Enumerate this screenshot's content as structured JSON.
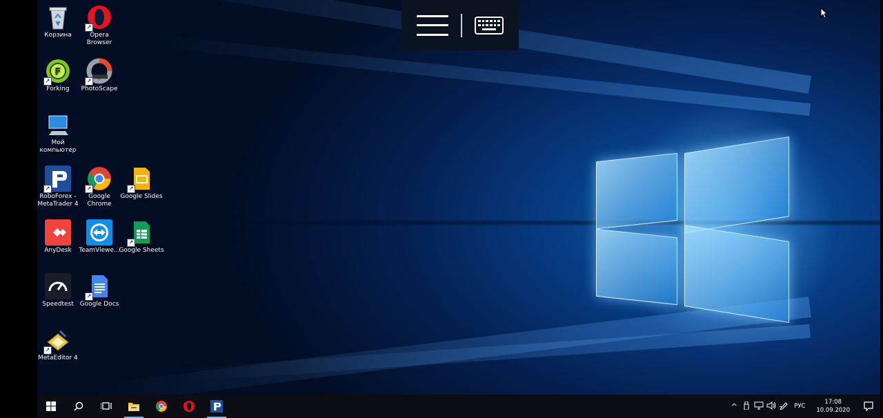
{
  "toolbar": {
    "menu_icon": "hamburger-menu-icon",
    "keyboard_icon": "keyboard-icon"
  },
  "desktop_icons": [
    {
      "label": "Корзина",
      "icon": "recycle-bin-icon"
    },
    {
      "label": "Opera Browser",
      "icon": "opera-icon"
    },
    {
      "label": "Forking",
      "icon": "forking-icon"
    },
    {
      "label": "PhotoScape",
      "icon": "photoscape-icon"
    },
    {
      "label": "Мой компьютер",
      "icon": "computer-icon"
    },
    {
      "label": "RoboForex - MetaTrader 4",
      "icon": "metatrader-icon"
    },
    {
      "label": "Google Chrome",
      "icon": "chrome-icon"
    },
    {
      "label": "Google Slides",
      "icon": "google-slides-icon"
    },
    {
      "label": "AnyDesk",
      "icon": "anydesk-icon"
    },
    {
      "label": "TeamViewe...",
      "icon": "teamviewer-icon"
    },
    {
      "label": "Google Sheets",
      "icon": "google-sheets-icon"
    },
    {
      "label": "Speedtest",
      "icon": "speedtest-icon"
    },
    {
      "label": "Google Docs",
      "icon": "google-docs-icon"
    },
    {
      "label": "MetaEditor 4",
      "icon": "metaeditor-icon"
    }
  ],
  "taskbar": {
    "start_icon": "windows-start-icon",
    "search_icon": "search-icon",
    "taskview_icon": "task-view-icon",
    "pinned": [
      "file-explorer-icon",
      "chrome-icon",
      "opera-icon",
      "metatrader-icon"
    ]
  },
  "tray": {
    "chevron": "^",
    "lang": "РУС",
    "time": "17:08",
    "date": "10.09.2020"
  },
  "colors": {
    "wallpaper_accent": "#0a5bb0",
    "taskbar": "#0a0d14",
    "toolbar": "#0b1220",
    "active_indicator": "#6ab0f3"
  }
}
